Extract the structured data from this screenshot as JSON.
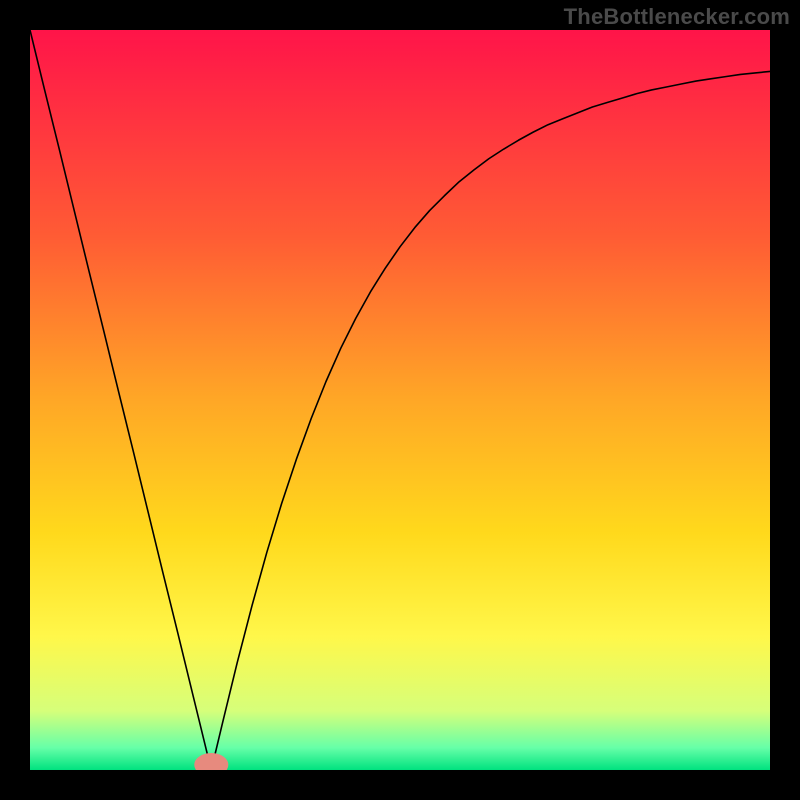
{
  "watermark": "TheBottlenecker.com",
  "chart_data": {
    "type": "line",
    "title": "",
    "xlabel": "",
    "ylabel": "",
    "xlim": [
      0,
      100
    ],
    "ylim": [
      0,
      100
    ],
    "grid": false,
    "background_gradient": {
      "type": "vertical",
      "stops": [
        {
          "pos": 0,
          "color": "#ff1449"
        },
        {
          "pos": 0.28,
          "color": "#ff5c34"
        },
        {
          "pos": 0.5,
          "color": "#ffa726"
        },
        {
          "pos": 0.68,
          "color": "#ffd91c"
        },
        {
          "pos": 0.82,
          "color": "#fff74a"
        },
        {
          "pos": 0.92,
          "color": "#d6ff7a"
        },
        {
          "pos": 0.97,
          "color": "#66ffa8"
        },
        {
          "pos": 1.0,
          "color": "#00e27f"
        }
      ]
    },
    "marker": {
      "x": 24.5,
      "y": 0.7,
      "rx": 2.3,
      "ry": 1.6,
      "color": "#e78a7e"
    },
    "series": [
      {
        "name": "curve",
        "color": "#000000",
        "width": 1.6,
        "x": [
          0,
          2,
          4,
          6,
          8,
          10,
          12,
          14,
          16,
          18,
          20,
          21,
          22,
          23,
          24,
          24.5,
          25,
          26,
          27,
          28,
          30,
          32,
          34,
          36,
          38,
          40,
          42,
          44,
          46,
          48,
          50,
          52,
          54,
          56,
          58,
          60,
          62,
          64,
          66,
          68,
          70,
          72,
          74,
          76,
          78,
          80,
          82,
          84,
          86,
          88,
          90,
          92,
          94,
          96,
          98,
          100
        ],
        "y": [
          100,
          91.8,
          83.7,
          75.5,
          67.3,
          59.2,
          51.0,
          42.9,
          34.7,
          26.5,
          18.4,
          14.3,
          10.2,
          6.1,
          2.0,
          0.0,
          2.1,
          6.3,
          10.4,
          14.5,
          22.2,
          29.4,
          36.0,
          42.0,
          47.5,
          52.5,
          57.0,
          61.0,
          64.6,
          67.8,
          70.7,
          73.3,
          75.6,
          77.6,
          79.5,
          81.1,
          82.6,
          83.9,
          85.1,
          86.2,
          87.2,
          88.0,
          88.8,
          89.6,
          90.2,
          90.8,
          91.4,
          91.9,
          92.3,
          92.7,
          93.1,
          93.4,
          93.7,
          94.0,
          94.2,
          94.4
        ]
      }
    ]
  }
}
